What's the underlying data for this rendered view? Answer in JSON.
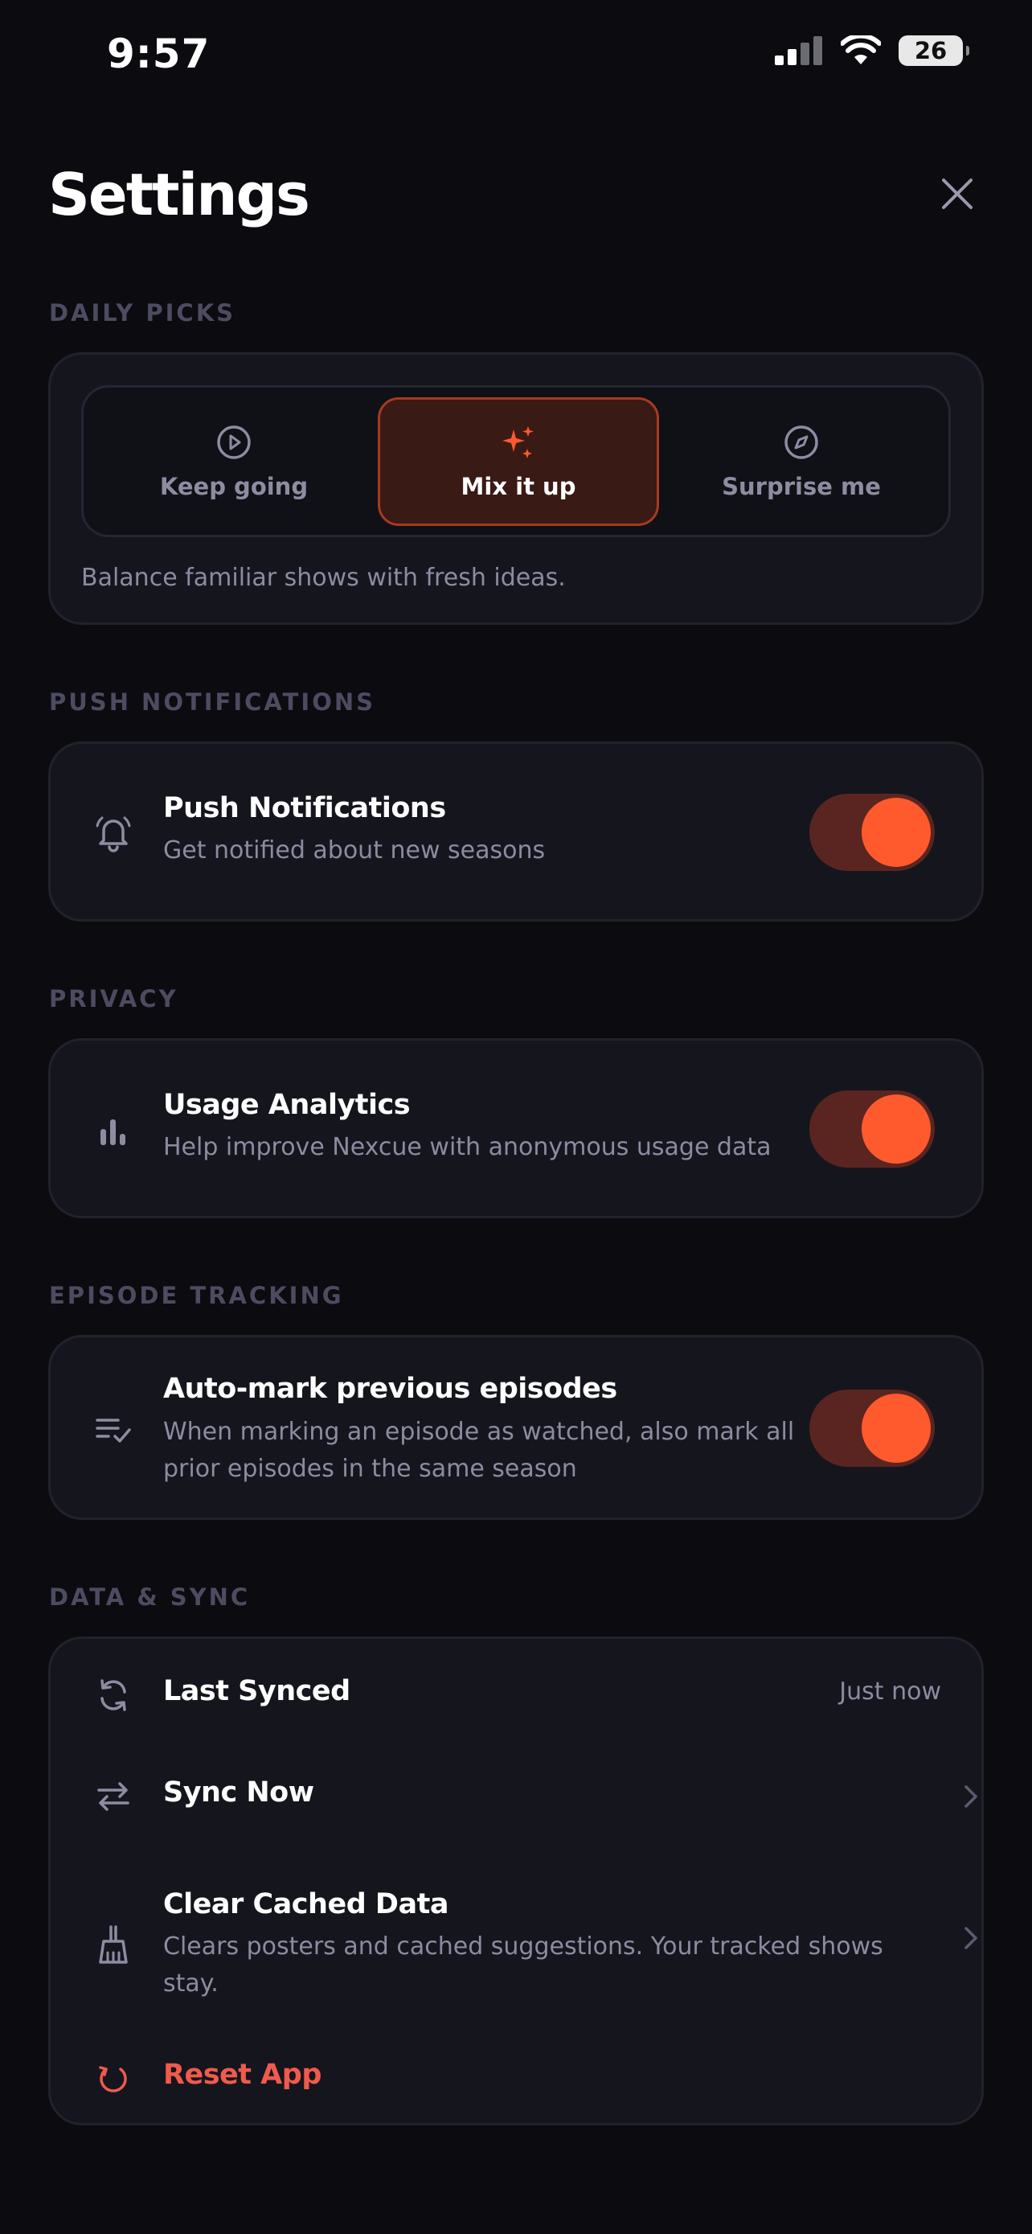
{
  "status_bar": {
    "time": "9:57",
    "battery": "26"
  },
  "header": {
    "title": "Settings"
  },
  "daily_picks": {
    "section_label": "DAILY PICKS",
    "options": [
      {
        "label": "Keep going",
        "icon": "play-circle-icon",
        "selected": false
      },
      {
        "label": "Mix it up",
        "icon": "sparkles-icon",
        "selected": true
      },
      {
        "label": "Surprise me",
        "icon": "compass-icon",
        "selected": false
      }
    ],
    "description": "Balance familiar shows with fresh ideas."
  },
  "push_notifications": {
    "section_label": "PUSH NOTIFICATIONS",
    "title": "Push Notifications",
    "subtitle": "Get notified about new seasons",
    "icon": "bell-icon",
    "enabled": true
  },
  "privacy": {
    "section_label": "PRIVACY",
    "title": "Usage Analytics",
    "subtitle": "Help improve Nexcue with anonymous usage data",
    "icon": "bar-chart-icon",
    "enabled": true
  },
  "episode_tracking": {
    "section_label": "EPISODE TRACKING",
    "title": "Auto-mark previous episodes",
    "subtitle_line1": "When marking an episode as watched, also mark all",
    "subtitle_line2": "prior episodes in the same season",
    "icon": "list-check-icon",
    "enabled": true
  },
  "data_sync": {
    "section_label": "DATA & SYNC",
    "last_synced": {
      "title": "Last Synced",
      "value": "Just now",
      "icon": "refresh-icon"
    },
    "sync_now": {
      "title": "Sync Now",
      "icon": "arrows-swap-icon"
    },
    "clear_cache": {
      "title": "Clear Cached Data",
      "subtitle_line1": "Clears posters and cached suggestions. Your tracked shows",
      "subtitle_line2": "stay.",
      "icon": "broom-icon"
    },
    "reset": {
      "title": "Reset App",
      "icon": "reset-icon"
    }
  },
  "colors": {
    "background": "#0b0b10",
    "card": "#15151e",
    "accent": "#ff5a2e",
    "danger": "#f05a4c",
    "muted_text": "#8d8ba0",
    "section_label": "#4d4b60"
  }
}
